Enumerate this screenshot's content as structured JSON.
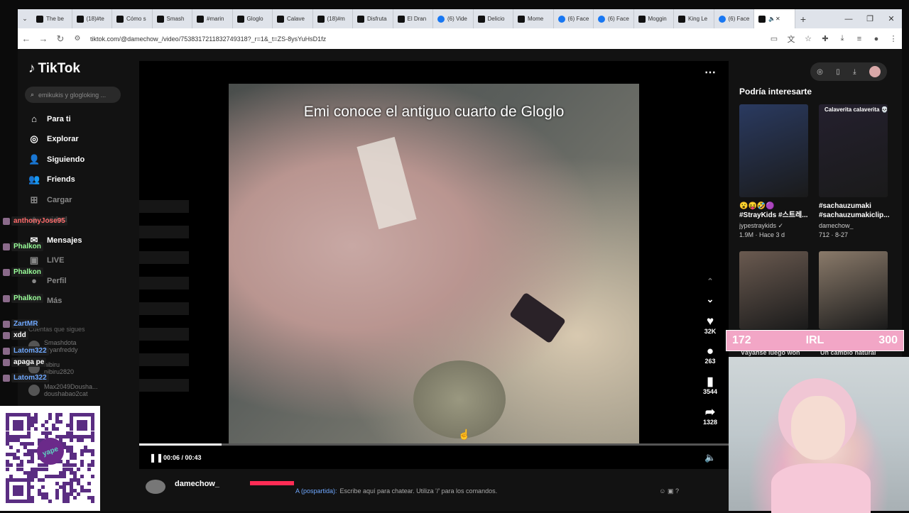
{
  "browser": {
    "tabs": [
      "The be",
      "(18)#te",
      "Cómo s",
      "Smash",
      "#marin",
      "Gloglo",
      "Calave",
      "(18)#m",
      "Disfruta",
      "El Dran",
      "(6) Vide",
      "Delicio",
      "Mome",
      "(6) Face",
      "(6) Face",
      "Moggin",
      "King Le",
      "(6) Face",
      ""
    ],
    "tab_fb": [
      false,
      false,
      false,
      false,
      false,
      false,
      false,
      false,
      false,
      false,
      true,
      false,
      false,
      true,
      true,
      false,
      false,
      true,
      false
    ],
    "url": "tiktok.com/@damechow_/video/7538317211832749318?_r=1&_t=ZS-8ysYuHsD1fz"
  },
  "tiktok": {
    "logo": "TikTok",
    "search_placeholder": "emikukis y glogloking ...",
    "nav": [
      {
        "label": "Para ti",
        "icon": "home-icon",
        "glyph": "⌂"
      },
      {
        "label": "Explorar",
        "icon": "compass-icon",
        "glyph": "◎"
      },
      {
        "label": "Siguiendo",
        "icon": "following-icon",
        "glyph": "👤"
      },
      {
        "label": "Friends",
        "icon": "friends-icon",
        "glyph": "👥"
      },
      {
        "label": "Cargar",
        "icon": "upload-icon",
        "glyph": "⊞"
      },
      {
        "label": "vidad",
        "icon": "activity-icon",
        "glyph": "◆"
      },
      {
        "label": "Mensajes",
        "icon": "messages-icon",
        "glyph": "✉"
      },
      {
        "label": "LIVE",
        "icon": "live-icon",
        "glyph": "▣"
      },
      {
        "label": "Perfil",
        "icon": "profile-icon",
        "glyph": "●"
      },
      {
        "label": "Más",
        "icon": "more-icon",
        "glyph": "⋯"
      }
    ],
    "following_title": "Cuentas que sigues",
    "following": [
      {
        "name": "Smashdota",
        "handle": "bryanfreddy"
      },
      {
        "name": "nibiru",
        "handle": "nibiru2820"
      },
      {
        "name": "Max2049Dousha...",
        "handle": "doushabao2cat"
      }
    ],
    "video": {
      "caption": "Emi conoce el antiguo cuarto de Gloglo",
      "time": "00:06 / 00:43",
      "progress": 0.14,
      "likes": "32K",
      "comments": "263",
      "saves": "3544",
      "shares": "1328",
      "author": "damechow_"
    },
    "recommend_title": "Podría interesarte",
    "cards": [
      {
        "line1": "😮😝🤣🟣 #StrayKids #스트레...",
        "line2": "jypestraykids ✓",
        "line3": "1.9M · Hace 3 d",
        "color": "#2a3a60"
      },
      {
        "line1": "#sachauzumaki #sachauzumakiclip...",
        "line2": "damechow_",
        "line3": "712 · 8-27",
        "title": "Calaverita calaverita 💀",
        "color": "#24202e"
      },
      {
        "line1": "Váyanse luego won",
        "color": "#6a5a50"
      },
      {
        "line1": "Un cambio natural",
        "color": "#8a7a6a"
      }
    ]
  },
  "overlay": {
    "chat": [
      {
        "name": "anthonyJose95",
        "color": "#ff6b6b"
      },
      {
        "name": "Phalkon",
        "color": "#9aff9a"
      },
      {
        "name": "Phalkon",
        "color": "#9aff9a"
      },
      {
        "name": "Phalkon",
        "color": "#9aff9a"
      },
      {
        "name": "ZartMR",
        "color": "#6fa8ff"
      },
      {
        "name": "xdd",
        "color": "#ffffff"
      },
      {
        "name": "Latom322",
        "color": "#6fa8ff"
      },
      {
        "name": "apaga pe",
        "color": "#ffffff"
      },
      {
        "name": "Latom322",
        "color": "#6fa8ff"
      }
    ],
    "qr_label": "yape",
    "counter_left": "172",
    "counter_mid": "IRL",
    "counter_right": "300",
    "chat_prefix": "A (pospartida):",
    "chat_placeholder": "Escribe aquí para chatear. Utiliza '/' para los comandos."
  }
}
